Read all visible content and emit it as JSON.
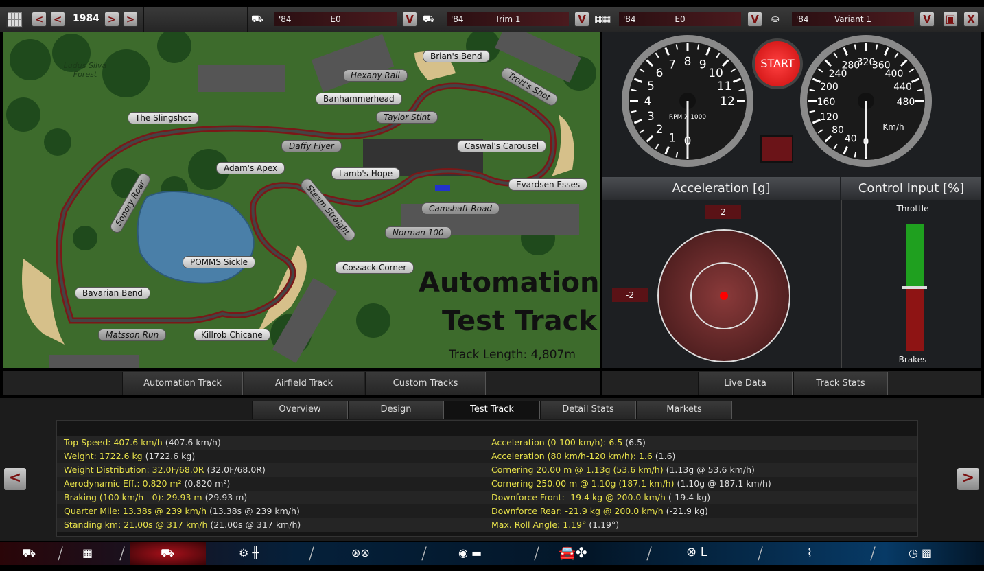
{
  "topbar": {
    "year": "1984",
    "prev_labels": [
      "<",
      "<"
    ],
    "next_labels": [
      ">",
      ">"
    ],
    "selectors": [
      {
        "icon": "car-body-icon",
        "year": "'84",
        "value": "E0",
        "dropdown": "V"
      },
      {
        "icon": "trim-icon",
        "year": "'84",
        "value": "Trim 1",
        "dropdown": "V"
      },
      {
        "icon": "engine-icon",
        "year": "'84",
        "value": "E0",
        "dropdown": "V"
      },
      {
        "icon": "variant-icon",
        "year": "'84",
        "value": "Variant 1",
        "dropdown": "V"
      }
    ],
    "save_icon": "save-icon",
    "close_label": "X"
  },
  "map": {
    "forest_label": "Ludus Silva Forest",
    "title_line1": "Automation",
    "title_line2": "Test Track",
    "track_length": "Track Length: 4,807m",
    "corners": [
      "Brian's Bend",
      "Hexany Rail",
      "Trott's Shot",
      "Banhammerhead",
      "Taylor Stint",
      "The Slingshot",
      "Daffy Flyer",
      "Caswal's Carousel",
      "Adam's Apex",
      "Lamb's Hope",
      "Evardsen Esses",
      "Sonory Roar",
      "Steam Straight",
      "Camshaft Road",
      "Norman 100",
      "POMMS Sickle",
      "Cossack Corner",
      "Bavarian Bend",
      "Matsson Run",
      "Killrob Chicane"
    ]
  },
  "track_tabs": [
    "Automation Track",
    "Airfield Track",
    "Custom Tracks"
  ],
  "gauges": {
    "rpm_label": "RPM X 1000",
    "rpm_ticks": [
      "0",
      "1",
      "2",
      "3",
      "4",
      "5",
      "6",
      "7",
      "8",
      "9",
      "10",
      "11",
      "12"
    ],
    "rpm_value": 0,
    "speed_unit": "Km/h",
    "speed_ticks": [
      "0",
      "40",
      "80",
      "120",
      "160",
      "200",
      "240",
      "280",
      "320",
      "360",
      "400",
      "440",
      "480"
    ],
    "speed_value": 0,
    "start_label": "START"
  },
  "acceleration": {
    "title": "Acceleration [g]",
    "top_label": "2",
    "left_label": "-2"
  },
  "control_input": {
    "title": "Control Input [%]",
    "throttle_label": "Throttle",
    "brakes_label": "Brakes",
    "throttle_pct": 0,
    "brakes_pct": 0,
    "colors": {
      "throttle": "#1fa01f",
      "brakes": "#8e1414"
    }
  },
  "data_tabs": [
    "Live Data",
    "Track Stats"
  ],
  "main_tabs": [
    "Overview",
    "Design",
    "Test Track",
    "Detail Stats",
    "Markets"
  ],
  "stats": {
    "left": [
      {
        "k": "Top Speed: 407.6 km/h",
        "p": " (407.6 km/h)"
      },
      {
        "k": "Weight: 1722.6 kg",
        "p": " (1722.6 kg)"
      },
      {
        "k": "Weight Distribution: 32.0F/68.0R",
        "p": " (32.0F/68.0R)"
      },
      {
        "k": "Aerodynamic Eff.: 0.820 m²",
        "p": " (0.820 m²)"
      },
      {
        "k": "Braking (100 km/h - 0): 29.93 m",
        "p": " (29.93 m)"
      },
      {
        "k": "Quarter Mile: 13.38s @ 239 km/h",
        "p": " (13.38s @ 239 km/h)"
      },
      {
        "k": "Standing km: 21.00s @ 317 km/h",
        "p": " (21.00s @ 317 km/h)"
      }
    ],
    "right": [
      {
        "k": "Acceleration (0-100 km/h): 6.5",
        "p": " (6.5)"
      },
      {
        "k": "Acceleration (80 km/h-120 km/h): 1.6",
        "p": " (1.6)"
      },
      {
        "k": "Cornering 20.00 m @ 1.13g (53.6 km/h)",
        "p": " (1.13g @ 53.6 km/h)"
      },
      {
        "k": "Cornering 250.00 m @ 1.10g (187.1 km/h)",
        "p": " (1.10g @ 187.1 km/h)"
      },
      {
        "k": "Downforce Front: -19.4 kg @ 200.0 km/h",
        "p": " (-19.4 kg)"
      },
      {
        "k": "Downforce Rear: -21.9 kg @ 200.0 km/h",
        "p": " (-21.9 kg)"
      },
      {
        "k": "Max. Roll Angle: 1.19°",
        "p": " (1.19°)"
      }
    ]
  },
  "side_arrows": {
    "left": "<",
    "right": ">"
  },
  "nav": [
    "car-body-icon",
    "engine-icon",
    "trim-icon",
    "gearbox-icon",
    "wheels-icon",
    "brakes-icon",
    "aero-cooling-icon",
    "interior-icon",
    "suspension-icon",
    "test-track-icon"
  ]
}
